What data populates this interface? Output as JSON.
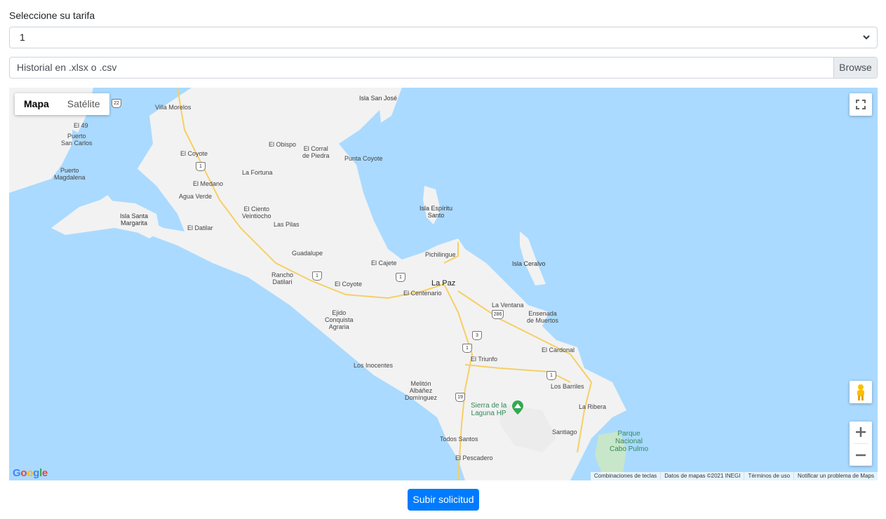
{
  "form": {
    "tariff_label": "Seleccione su tarifa",
    "tariff_value": "1",
    "file_placeholder": "Historial en .xlsx o .csv",
    "browse_label": "Browse",
    "submit_label": "Subir solicitud"
  },
  "map": {
    "type_buttons": [
      "Mapa",
      "Satélite"
    ],
    "active_type": "Mapa",
    "logo": "Google",
    "attribution": [
      "Combinaciones de teclas",
      "Datos de mapas ©2021 INEGI",
      "Términos de uso",
      "Notificar un problema de Maps"
    ],
    "places": {
      "villa_morelos": "Villa Morelos",
      "el_49": "El 49",
      "puerto_san_carlos": "Puerto\nSan Carlos",
      "puerto_magdalena": "Puerto\nMagdalena",
      "isla_santa_margarita": "Isla Santa\nMargarita",
      "el_coyote_n": "El Coyote",
      "el_obispo": "El Obispo",
      "el_corral": "El Corral\nde Piedra",
      "punta_coyote": "Punta Coyote",
      "la_fortuna": "La Fortuna",
      "el_medano": "El Medano",
      "agua_verde": "Agua Verde",
      "el_ciento": "El Ciento\nVeintiocho",
      "el_datilar": "El Datilar",
      "las_pilas": "Las Pilas",
      "guadalupe": "Guadalupe",
      "rancho_datilari": "Rancho\nDatilari",
      "el_coyote_s": "El Coyote",
      "el_cajete": "El Cajete",
      "pichilingue": "Pichilingue",
      "isla_san_jose": "Isla San José",
      "isla_espiritu": "Isla Espíritu\nSanto",
      "isla_ceralvo": "Isla Ceralvo",
      "la_paz": "La Paz",
      "el_centenario": "El Centenario",
      "la_ventana": "La Ventana",
      "ensenada": "Ensenada\nde Muertos",
      "ejido": "Ejido\nConquista\nAgraria",
      "el_cardonal": "El Cardonal",
      "el_triunfo": "El Triunfo",
      "los_inocentes": "Los Inocentes",
      "los_barriles": "Los Barriles",
      "melliton": "Melitón\nAlbáñez\nDomínguez",
      "sierra": "Sierra de la\nLaguna HP",
      "la_ribera": "La Ribera",
      "santiago": "Santiago",
      "parque": "Parque\nNacional\nCabo Pulmo",
      "todos_santos": "Todos Santos",
      "el_pescadero": "El Pescadero"
    },
    "shields": [
      "22",
      "1",
      "1",
      "1",
      "286",
      "3",
      "1",
      "1",
      "19"
    ]
  },
  "colors": {
    "water": "#aadaff",
    "land": "#f2f2f2",
    "road": "#f6cf65",
    "primary_button": "#007bff"
  },
  "icons": {
    "fullscreen": "fullscreen-icon",
    "pegman": "pegman-icon",
    "zoom_in": "plus-icon",
    "zoom_out": "minus-icon",
    "select_chevron": "chevron-down-icon"
  }
}
